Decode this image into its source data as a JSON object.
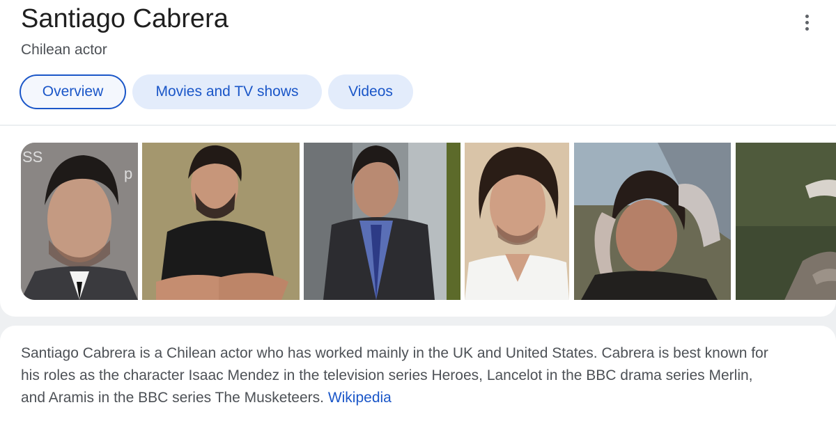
{
  "header": {
    "title": "Santiago Cabrera",
    "subtitle": "Chilean actor",
    "more_icon": "more-vert-icon"
  },
  "tabs": [
    {
      "label": "Overview",
      "active": true
    },
    {
      "label": "Movies and TV shows",
      "active": false
    },
    {
      "label": "Videos",
      "active": false
    }
  ],
  "gallery": {
    "photos": [
      {
        "overlay_text": "SS"
      },
      {},
      {},
      {},
      {},
      {}
    ]
  },
  "description": {
    "line1": "Santiago Cabrera is a Chilean actor who has worked mainly in the UK and United States. Cabrera is best known for",
    "line2": "his roles as the character Isaac Mendez in the television series Heroes, Lancelot in the BBC drama series Merlin,",
    "line3": "and Aramis in the BBC series The Musketeers. ",
    "source_link": "Wikipedia"
  },
  "colors": {
    "link": "#1a56c8",
    "tab_bg": "#e3ecfb",
    "text_primary": "#1f1f1f",
    "text_secondary": "#4d5156"
  }
}
